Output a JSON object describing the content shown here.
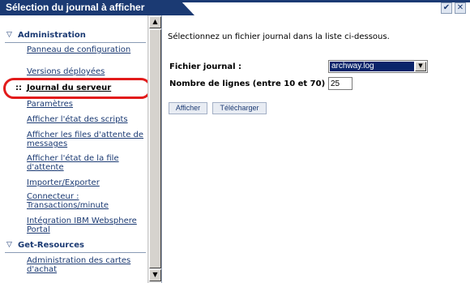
{
  "window": {
    "title": "Sélection du journal à afficher",
    "ok_glyph": "✔",
    "close_glyph": "✕"
  },
  "sidebar": {
    "groups": [
      {
        "label": "Administration",
        "items": [
          {
            "label": "Panneau de configuration",
            "selected": false
          },
          {
            "label": "Versions déployées",
            "selected": false
          },
          {
            "label": "Journal du serveur",
            "selected": true
          },
          {
            "label": "Paramètres",
            "selected": false
          },
          {
            "label": "Afficher l'état des scripts",
            "selected": false
          },
          {
            "label": "Afficher les files d'attente de messages",
            "selected": false
          },
          {
            "label": "Afficher l'état de la file d'attente",
            "selected": false
          },
          {
            "label": "Importer/Exporter",
            "selected": false
          },
          {
            "label": "Connecteur : Transactions/minute",
            "selected": false
          },
          {
            "label": "Intégration IBM Websphere Portal",
            "selected": false
          }
        ]
      },
      {
        "label": "Get-Resources",
        "items": [
          {
            "label": "Administration des cartes d'achat",
            "selected": false
          }
        ]
      }
    ],
    "selected_marker": "::"
  },
  "main": {
    "instruction": "Sélectionnez un fichier journal dans la liste ci-dessous.",
    "log_file_label": "Fichier journal :",
    "log_file_value": "archway.log",
    "lines_label": "Nombre de lignes (entre 10 et 70) :",
    "lines_value": "25",
    "buttons": {
      "show": "Afficher",
      "download": "Télécharger"
    }
  },
  "colors": {
    "titlebar": "#1b3a73",
    "link": "#1b3a73",
    "highlight_oval": "#e21b1b",
    "select_highlight": "#0a246a"
  }
}
